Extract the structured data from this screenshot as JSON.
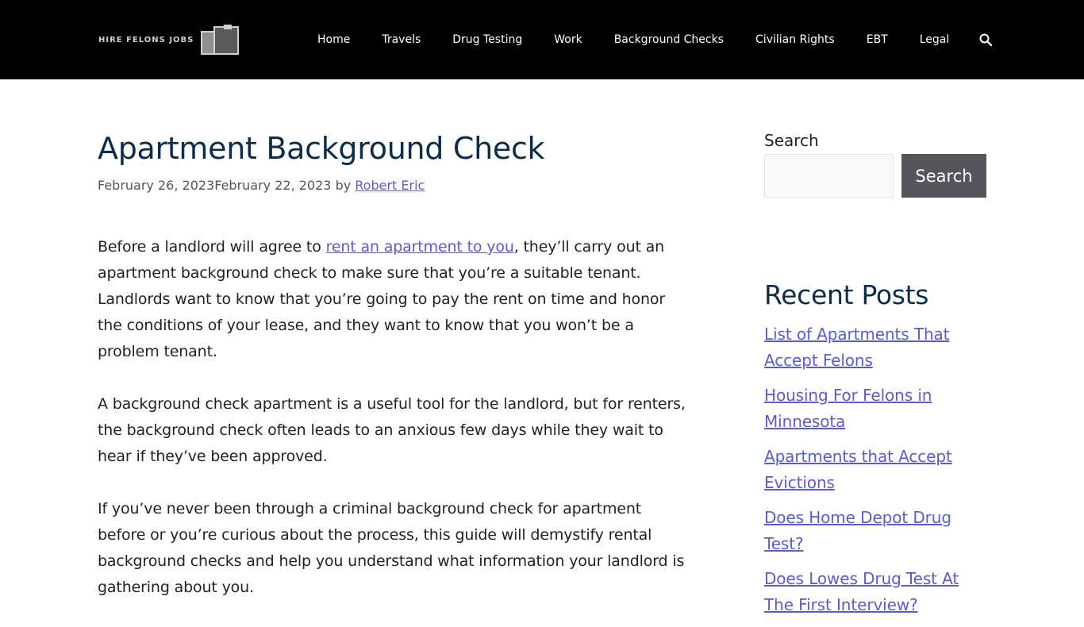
{
  "header": {
    "logo_text": "HIRE FELONS JOBS",
    "nav": [
      "Home",
      "Travels",
      "Drug Testing",
      "Work",
      "Background Checks",
      "Civilian Rights",
      "EBT",
      "Legal"
    ]
  },
  "article": {
    "title": "Apartment Background Check",
    "published": "February 26, 2023",
    "updated": "February 22, 2023",
    "by": "by",
    "author": "Robert Eric",
    "p1_before": "Before a landlord will agree to ",
    "p1_link": "rent an apartment to you",
    "p1_after": ", they’ll carry out an apartment background check to make sure that you’re a suitable tenant. Landlords want to know that you’re going to pay the rent on time and honor the conditions of your lease, and they want to know that you won’t be a problem tenant.",
    "p2": "A background check apartment is a useful tool for the landlord, but for renters, the background check often leads to an anxious few days while they wait to hear if they’ve been approved.",
    "p3": "If you’ve never been through a criminal background check for apartment before or you’re curious about the process, this guide will demystify rental background checks and help you understand what information your landlord is gathering about you."
  },
  "sidebar": {
    "search_label": "Search",
    "search_value": "",
    "search_button": "Search",
    "recent_heading": "Recent Posts",
    "recent_posts": [
      "List of Apartments That Accept Felons",
      "Housing For Felons in Minnesota",
      "Apartments that Accept Evictions",
      "Does Home Depot Drug Test?",
      "Does Lowes Drug Test At The First Interview?"
    ]
  },
  "icons": {
    "search": "magnifier-icon",
    "logo": "building-icon"
  },
  "colors": {
    "header_bg": "#000000",
    "title": "#0b2c4a",
    "link": "#5b5bd6",
    "button": "#55555e"
  }
}
